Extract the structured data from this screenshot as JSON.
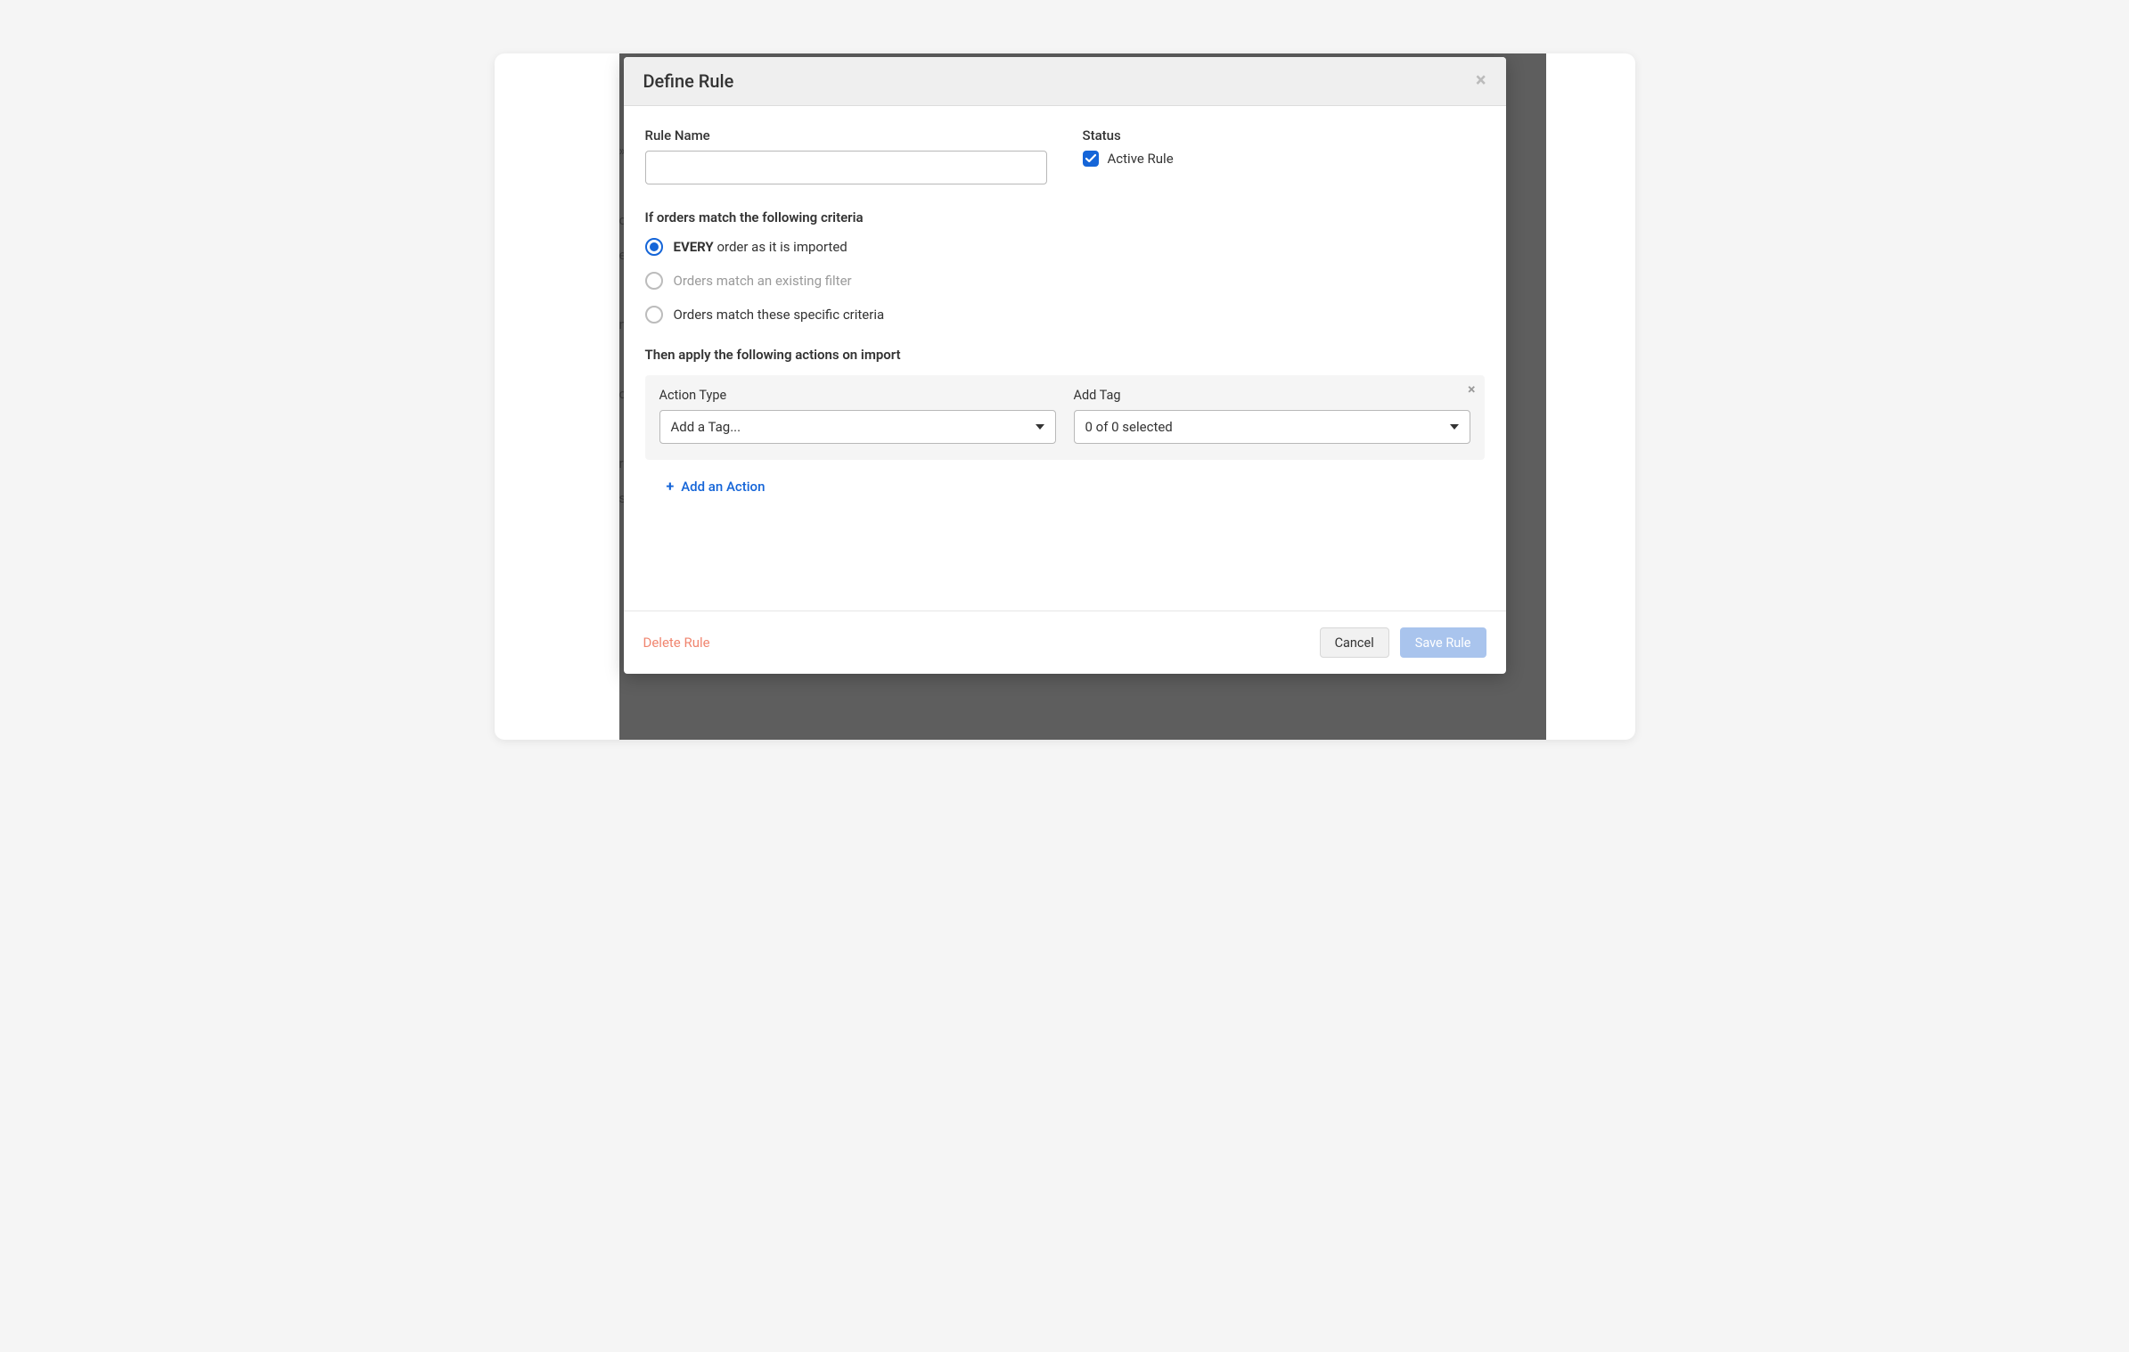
{
  "modal": {
    "title": "Define Rule",
    "rule_name_label": "Rule Name",
    "rule_name_value": "",
    "status_label": "Status",
    "active_rule_label": "Active Rule",
    "criteria_heading": "If orders match the following criteria",
    "criteria_options": {
      "every_pre": "EVERY",
      "every_post": " order as it is imported",
      "existing_filter": "Orders match an existing filter",
      "specific": "Orders match these specific criteria"
    },
    "actions_heading": "Then apply the following actions on import",
    "action": {
      "type_label": "Action Type",
      "type_value": "Add a Tag...",
      "tag_label": "Add Tag",
      "tag_value": "0 of 0 selected"
    },
    "add_action_label": "Add an Action",
    "footer": {
      "delete": "Delete Rule",
      "cancel": "Cancel",
      "save": "Save Rule"
    }
  },
  "background_fragments": "»\n\nc\ne\n\nn\n\nc\n\nr\ns"
}
